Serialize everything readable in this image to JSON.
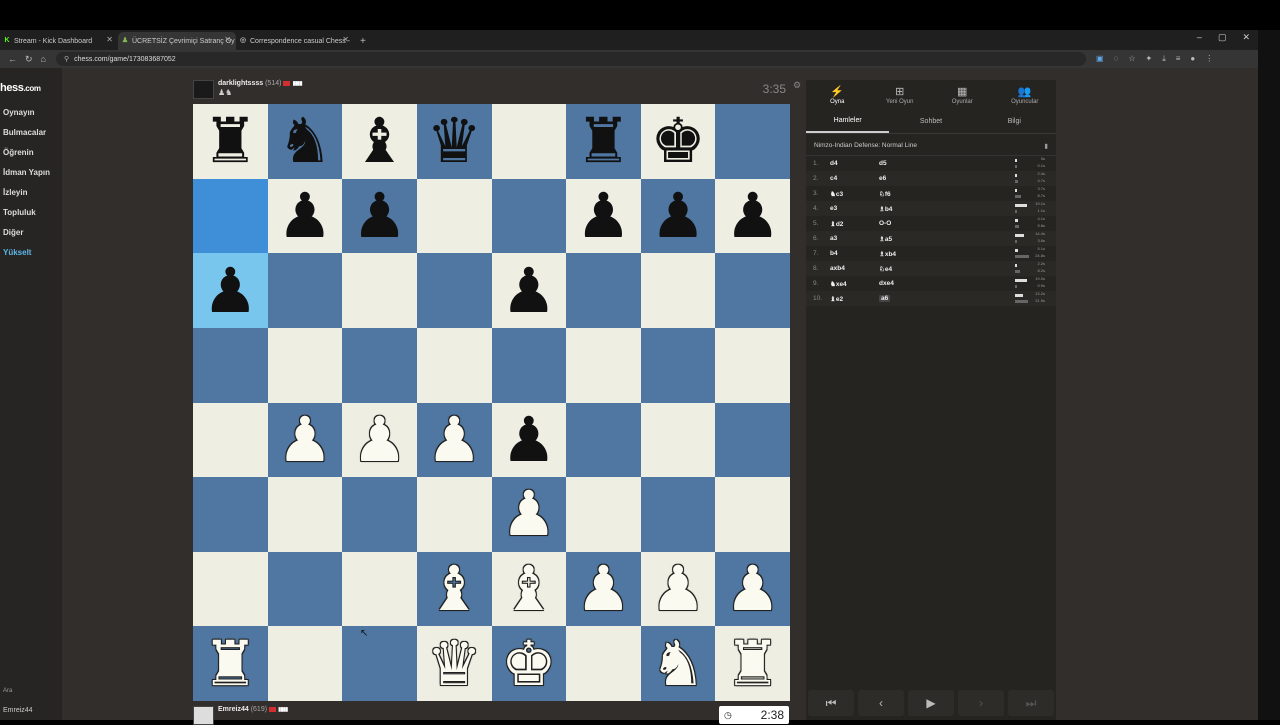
{
  "browser": {
    "tabs": [
      {
        "title": "Stream - Kick Dashboard",
        "favicon": "K",
        "fav_color": "#53fc18"
      },
      {
        "title": "ÜCRETSİZ Çevrimiçi Satranç Oy",
        "favicon": "♟",
        "fav_color": "#81b64c"
      },
      {
        "title": "Correspondence casual Chess -",
        "favicon": "◎",
        "fav_color": "#aaaaaa"
      }
    ],
    "url": "chess.com/game/173083687052",
    "new_tab": "+",
    "controls": [
      "–",
      "▢",
      "✕"
    ]
  },
  "sidebar": {
    "logo_main": "hess",
    "logo_suffix": ".com",
    "items": [
      "Oynayın",
      "Bulmacalar",
      "Öğrenin",
      "İdman Yapın",
      "İzleyin",
      "Topluluk",
      "Diğer",
      "Yükselt"
    ],
    "search": "Ara",
    "user": "Emreiz44"
  },
  "top_player": {
    "name": "darklightssss",
    "rating": "(514)",
    "captured": "♟♞",
    "clock": "3:35"
  },
  "bottom_player": {
    "name": "Emreiz44",
    "rating": "(619)",
    "clock": "2:38"
  },
  "board": {
    "ranks": [
      [
        "r",
        "n",
        "b",
        "q",
        "",
        "r",
        "k",
        ""
      ],
      [
        "",
        "p",
        "p",
        "",
        "",
        "p",
        "p",
        "p"
      ],
      [
        "p",
        "",
        "",
        "",
        "p",
        "",
        "",
        ""
      ],
      [
        "",
        "",
        "",
        "",
        "",
        "",
        "",
        ""
      ],
      [
        "",
        "P",
        "P",
        "P",
        "p",
        "",
        "",
        ""
      ],
      [
        "",
        "",
        "",
        "",
        "P",
        "",
        "",
        ""
      ],
      [
        "",
        "",
        "",
        "B",
        "B",
        "P",
        "P",
        "P"
      ],
      [
        "R",
        "",
        "",
        "Q",
        "K",
        "",
        "N",
        "R"
      ]
    ],
    "highlight": [
      [
        1,
        0
      ],
      [
        2,
        0
      ]
    ]
  },
  "panel": {
    "tabs": [
      {
        "label": "Oyna",
        "icon": "⚡"
      },
      {
        "label": "Yeni Oyun",
        "icon": "⊞"
      },
      {
        "label": "Oyunlar",
        "icon": "▦"
      },
      {
        "label": "Oyuncular",
        "icon": "👥"
      }
    ],
    "subtabs": [
      "Hamleler",
      "Sohbet",
      "Bilgi"
    ],
    "opening": "Nimzo-Indian Defense: Normal Line",
    "moves": [
      {
        "n": "1.",
        "w": "d4",
        "b": "d5",
        "tw": "0s",
        "tb": "0.1s",
        "fw": 0.05,
        "fb": 0.05
      },
      {
        "n": "2.",
        "w": "c4",
        "b": "e6",
        "tw": "2.4s",
        "tb": "4.7s",
        "fw": 0.12,
        "fb": 0.22
      },
      {
        "n": "3.",
        "w": "♞c3",
        "b": "♘f6",
        "tw": "3.7s",
        "tb": "8.7s",
        "fw": 0.17,
        "fb": 0.4
      },
      {
        "n": "4.",
        "w": "e3",
        "b": "♗b4",
        "tw": "19.1s",
        "tb": "1.1s",
        "fw": 0.85,
        "fb": 0.05
      },
      {
        "n": "5.",
        "w": "♝d2",
        "b": "O-O",
        "tw": "4.1s",
        "tb": "5.8s",
        "fw": 0.18,
        "fb": 0.26
      },
      {
        "n": "6.",
        "w": "a3",
        "b": "♗a5",
        "tw": "14.4s",
        "tb": "3.6s",
        "fw": 0.64,
        "fb": 0.16
      },
      {
        "n": "7.",
        "w": "b4",
        "b": "♗xb4",
        "tw": "5.1s",
        "tb": "24.8s",
        "fw": 0.23,
        "fb": 1
      },
      {
        "n": "8.",
        "w": "axb4",
        "b": "♘e4",
        "tw": "2.2s",
        "tb": "8.2s",
        "fw": 0.1,
        "fb": 0.37
      },
      {
        "n": "9.",
        "w": "♞xe4",
        "b": "dxe4",
        "tw": "19.0s",
        "tb": "0.9s",
        "fw": 0.85,
        "fb": 0.04
      },
      {
        "n": "10.",
        "w": "♝e2",
        "b": "a6",
        "tw": "13.2s",
        "tb": "21.5s",
        "fw": 0.59,
        "fb": 0.96
      }
    ],
    "nav": [
      "⏮",
      "‹",
      "▶",
      "›",
      "⏭"
    ]
  }
}
